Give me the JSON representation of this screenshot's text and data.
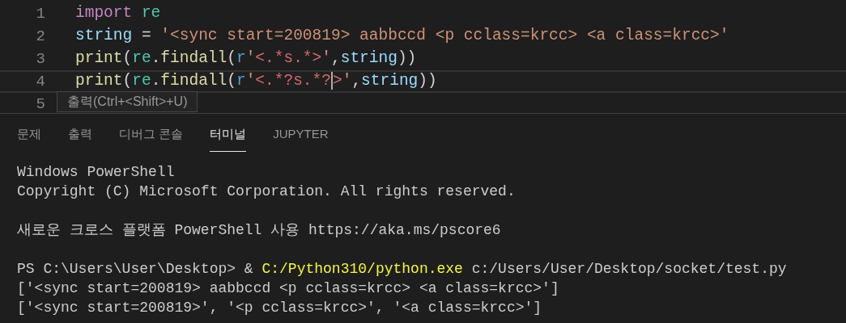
{
  "editor": {
    "lines": [
      {
        "number": "1",
        "current": false,
        "tokens": [
          {
            "kind": "keyword",
            "text": "import"
          },
          {
            "kind": "module",
            "text": " re"
          }
        ]
      },
      {
        "number": "2",
        "current": false,
        "tokens": [
          {
            "kind": "variable",
            "text": "string"
          },
          {
            "kind": "plain",
            "text": " = "
          },
          {
            "kind": "string",
            "text": "'<sync start=200819> aabbccd <p cclass=krcc> <a class=krcc>'"
          }
        ]
      },
      {
        "number": "3",
        "current": false,
        "tokens": [
          {
            "kind": "function",
            "text": "print"
          },
          {
            "kind": "plain",
            "text": "("
          },
          {
            "kind": "module",
            "text": "re"
          },
          {
            "kind": "plain",
            "text": "."
          },
          {
            "kind": "function",
            "text": "findall"
          },
          {
            "kind": "plain",
            "text": "("
          },
          {
            "kind": "prefix",
            "text": "r"
          },
          {
            "kind": "string",
            "text": "'"
          },
          {
            "kind": "regex",
            "text": "<.*s.*>"
          },
          {
            "kind": "string",
            "text": "'"
          },
          {
            "kind": "plain",
            "text": ","
          },
          {
            "kind": "variable",
            "text": "string"
          },
          {
            "kind": "plain",
            "text": "))"
          }
        ]
      },
      {
        "number": "4",
        "current": true,
        "tokens": [
          {
            "kind": "function",
            "text": "print"
          },
          {
            "kind": "plain",
            "text": "("
          },
          {
            "kind": "module",
            "text": "re"
          },
          {
            "kind": "plain",
            "text": "."
          },
          {
            "kind": "function",
            "text": "findall"
          },
          {
            "kind": "plain",
            "text": "("
          },
          {
            "kind": "prefix",
            "text": "r"
          },
          {
            "kind": "string",
            "text": "'"
          },
          {
            "kind": "regex",
            "text": "<.*?s.*?",
            "cursor": true
          },
          {
            "kind": "regex",
            "text": ">"
          },
          {
            "kind": "string",
            "text": "'"
          },
          {
            "kind": "plain",
            "text": ","
          },
          {
            "kind": "variable",
            "text": "string"
          },
          {
            "kind": "plain",
            "text": "))"
          }
        ]
      },
      {
        "number": "5",
        "current": false
      }
    ]
  },
  "tooltip": "출력(Ctrl+<Shift>+U)",
  "panel_tabs": [
    {
      "label": "문제",
      "selected": false
    },
    {
      "label": "출력",
      "selected": false
    },
    {
      "label": "디버그 콘솔",
      "selected": false
    },
    {
      "label": "터미널",
      "selected": true
    },
    {
      "label": "JUPYTER",
      "selected": false
    }
  ],
  "terminal": [
    [
      [
        {
          "kind": "plain",
          "text": "Windows PowerShell"
        }
      ],
      [
        {
          "kind": "plain",
          "text": "Copyright (C) Microsoft Corporation. All rights reserved."
        }
      ]
    ],
    [
      [
        {
          "kind": "plain",
          "text": "새로운 크로스 플랫폼 PowerShell 사용 https://aka.ms/pscore6"
        }
      ]
    ],
    [
      [
        {
          "kind": "plain",
          "text": "PS C:\\Users\\User\\Desktop> & "
        },
        {
          "kind": "command",
          "text": "C:/Python310/python.exe"
        },
        {
          "kind": "plain",
          "text": " c:/Users/User/Desktop/socket/test.py"
        }
      ],
      [
        {
          "kind": "plain",
          "text": "['<sync start=200819> aabbccd <p cclass=krcc> <a class=krcc>']"
        }
      ],
      [
        {
          "kind": "plain",
          "text": "['<sync start=200819>', '<p cclass=krcc>', '<a class=krcc>']"
        }
      ]
    ]
  ]
}
